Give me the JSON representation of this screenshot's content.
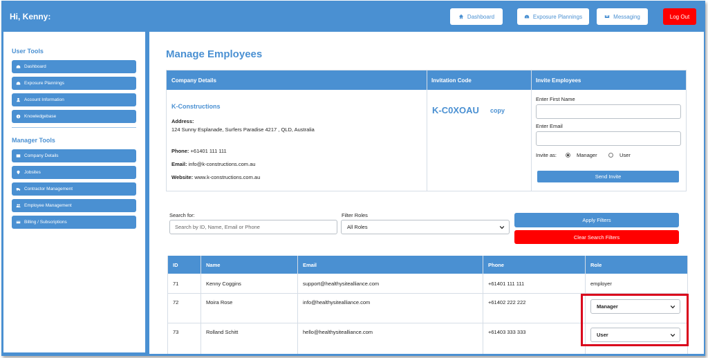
{
  "header": {
    "greeting": "Hi, Kenny:",
    "nav": [
      {
        "label": "Dashboard",
        "icon": "home-icon"
      },
      {
        "label": "Exposure Plannings",
        "icon": "gauge-icon"
      },
      {
        "label": "Messaging",
        "icon": "envelope-icon"
      }
    ],
    "logout_label": "Log Out"
  },
  "sidebar": {
    "user_tools_title": "User Tools",
    "user_items": [
      {
        "label": "Dashboard",
        "icon": "gauge-icon"
      },
      {
        "label": "Exposure Plannings",
        "icon": "gauge-icon"
      },
      {
        "label": "Account Information",
        "icon": "user-icon"
      },
      {
        "label": "Knowledgebase",
        "icon": "info-icon"
      }
    ],
    "manager_tools_title": "Manager Tools",
    "manager_items": [
      {
        "label": "Company Details",
        "icon": "table-icon"
      },
      {
        "label": "Jobsites",
        "icon": "map-pin-icon"
      },
      {
        "label": "Contractor Management",
        "icon": "truck-icon"
      },
      {
        "label": "Employee Management",
        "icon": "users-icon"
      },
      {
        "label": "Billing / Subscriptions",
        "icon": "credit-card-icon"
      }
    ]
  },
  "main": {
    "title": "Manage Employees",
    "company": {
      "header_details": "Company Details",
      "header_invitation": "Invitation Code",
      "header_invite": "Invite Employees",
      "name": "K-Constructions",
      "address_label": "Address:",
      "address": "124 Sunny Esplanade, Surfers Paradise 4217 , QLD, Australia",
      "phone_label": "Phone:",
      "phone": "+61401 111 111",
      "email_label": "Email:",
      "email": "info@k-constructions.com.au",
      "website_label": "Website:",
      "website": "www.k-constructions.com.au",
      "invitation_code": "K-C0XOAU",
      "copy_label": "copy",
      "first_name_label": "Enter First Name",
      "email_input_label": "Enter Email",
      "invite_as_label": "Invite as:",
      "invite_options": [
        "Manager",
        "User"
      ],
      "invite_selected": "Manager",
      "send_invite_label": "Send Invite"
    },
    "filters": {
      "search_label": "Search for:",
      "search_placeholder": "Search by ID, Name, Email or Phone",
      "roles_label": "Filter Roles",
      "roles_value": "All Roles",
      "apply_label": "Apply Filters",
      "clear_label": "Clear Search Filters"
    },
    "employees": {
      "columns": [
        "ID",
        "Name",
        "Email",
        "Phone",
        "Role"
      ],
      "rows": [
        {
          "id": "71",
          "name": "Kenny Coggins",
          "email": "support@healthysitealliance.com",
          "phone": "+61401 111 111",
          "role": "employer"
        },
        {
          "id": "72",
          "name": "Moira Rose",
          "email": "info@healthysitealliance.com",
          "phone": "+61402 222 222",
          "role": "Manager"
        },
        {
          "id": "73",
          "name": "Rolland Schitt",
          "email": "hello@healthysitealliance.com",
          "phone": "+61403 333 333",
          "role": "User"
        }
      ]
    }
  },
  "colors": {
    "primary": "#4a90d2",
    "danger": "#ff0000",
    "highlight": "#d9001b"
  }
}
